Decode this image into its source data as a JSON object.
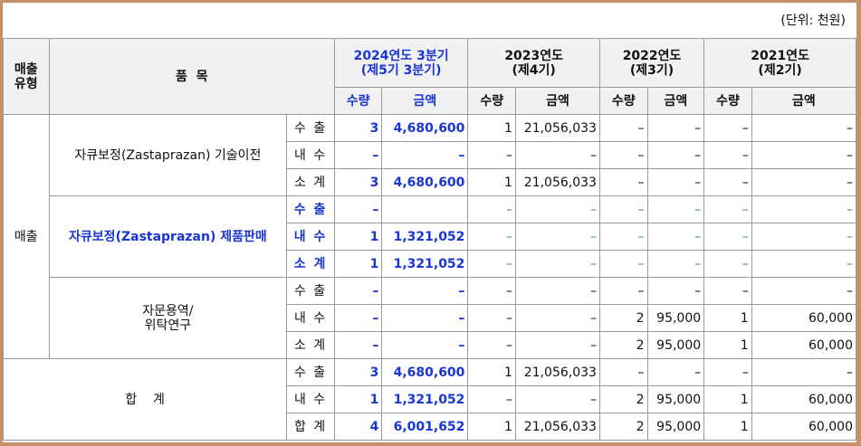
{
  "unit": "(단위: 천원)",
  "headers": {
    "type": "매출\n유형",
    "item": "품  목",
    "p2024": "2024연도 3분기\n(제5기 3분기)",
    "p2023": "2023연도\n(제4기)",
    "p2022": "2022연도\n(제3기)",
    "p2021": "2021연도\n(제2기)",
    "qty": "수량",
    "amt": "금액"
  },
  "sales_type": "매출",
  "groups": [
    {
      "name": "자큐보정(Zastaprazan) 기술이전",
      "highlight": false,
      "rows": [
        {
          "sub": "수 출",
          "v": [
            "3",
            "4,680,600",
            "1",
            "21,056,033",
            "–",
            "–",
            "–",
            "–"
          ]
        },
        {
          "sub": "내 수",
          "v": [
            "–",
            "–",
            "–",
            "–",
            "–",
            "–",
            "–",
            "–"
          ]
        },
        {
          "sub": "소 계",
          "v": [
            "3",
            "4,680,600",
            "1",
            "21,056,033",
            "–",
            "–",
            "–",
            "–"
          ]
        }
      ]
    },
    {
      "name": "자큐보정(Zastaprazan) 제품판매",
      "highlight": true,
      "rows": [
        {
          "sub": "수 출",
          "v": [
            "–",
            "",
            "–",
            "–",
            "–",
            "–",
            "–",
            "–"
          ]
        },
        {
          "sub": "내 수",
          "v": [
            "1",
            "1,321,052",
            "–",
            "–",
            "–",
            "–",
            "–",
            "–"
          ]
        },
        {
          "sub": "소 계",
          "v": [
            "1",
            "1,321,052",
            "–",
            "–",
            "–",
            "–",
            "–",
            "–"
          ]
        }
      ]
    },
    {
      "name": "자문용역/\n위탁연구",
      "highlight": false,
      "rows": [
        {
          "sub": "수 출",
          "v": [
            "–",
            "–",
            "–",
            "–",
            "–",
            "–",
            "–",
            "–"
          ]
        },
        {
          "sub": "내 수",
          "v": [
            "–",
            "–",
            "–",
            "–",
            "2",
            "95,000",
            "1",
            "60,000"
          ]
        },
        {
          "sub": "소 계",
          "v": [
            "–",
            "–",
            "–",
            "–",
            "2",
            "95,000",
            "1",
            "60,000"
          ]
        }
      ]
    }
  ],
  "total": {
    "name": "합    계",
    "rows": [
      {
        "sub": "수 출",
        "v": [
          "3",
          "4,680,600",
          "1",
          "21,056,033",
          "–",
          "–",
          "–",
          "–"
        ]
      },
      {
        "sub": "내 수",
        "v": [
          "1",
          "1,321,052",
          "–",
          "–",
          "2",
          "95,000",
          "1",
          "60,000"
        ]
      },
      {
        "sub": "합 계",
        "v": [
          "4",
          "6,001,652",
          "1",
          "21,056,033",
          "2",
          "95,000",
          "1",
          "60,000"
        ]
      }
    ]
  },
  "colors": {
    "highlight": "#1a35d6",
    "header_bg": "#f1f1f1",
    "frame": "#c4916a"
  }
}
